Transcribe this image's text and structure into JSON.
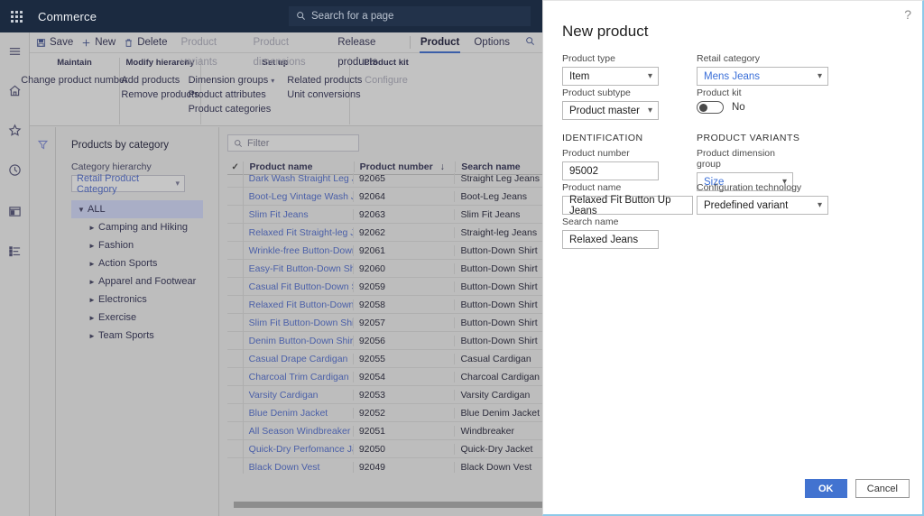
{
  "topbar": {
    "waffle_icon": "app-launcher-icon",
    "title": "Commerce",
    "search_icon": "search-icon",
    "search_placeholder": "Search for a page"
  },
  "rail": {
    "items": [
      {
        "name": "hamburger-icon",
        "label": "Expand navigation"
      },
      {
        "name": "home-icon",
        "label": "Home"
      },
      {
        "name": "star-icon",
        "label": "Favorites"
      },
      {
        "name": "clock-icon",
        "label": "Recent"
      },
      {
        "name": "workspace-icon",
        "label": "Workspaces"
      },
      {
        "name": "modules-icon",
        "label": "Modules"
      }
    ]
  },
  "ribbon": {
    "quick_actions": [
      {
        "label": "Save",
        "icon": "save-icon",
        "disabled": false
      },
      {
        "label": "New",
        "icon": "plus-icon",
        "disabled": false
      },
      {
        "label": "Delete",
        "icon": "trash-icon",
        "disabled": false
      }
    ],
    "tabs": [
      {
        "label": "Product variants",
        "active": false,
        "disabled": true
      },
      {
        "label": "Product dimensions",
        "active": false,
        "disabled": true
      },
      {
        "label": "Release products",
        "active": false,
        "disabled": false
      },
      {
        "label": "Product",
        "active": true,
        "disabled": false
      },
      {
        "label": "Options",
        "active": false,
        "disabled": false
      }
    ],
    "search_icon": "search-icon",
    "groups": [
      {
        "title": "Maintain",
        "columns": [
          {
            "items": [
              {
                "label": "Change product number",
                "disabled": false
              }
            ]
          }
        ]
      },
      {
        "title": "Modify hierarchy",
        "columns": [
          {
            "items": [
              {
                "label": "Add products",
                "disabled": false
              },
              {
                "label": "Remove products",
                "disabled": false
              }
            ]
          }
        ]
      },
      {
        "title": "Set up",
        "columns": [
          {
            "items": [
              {
                "label": "Dimension groups",
                "disabled": false,
                "chevron": true
              },
              {
                "label": "Product attributes",
                "disabled": false
              },
              {
                "label": "Product categories",
                "disabled": false
              }
            ]
          },
          {
            "items": [
              {
                "label": "Related products",
                "disabled": false
              },
              {
                "label": "Unit conversions",
                "disabled": false
              }
            ]
          }
        ]
      },
      {
        "title": "Product kit",
        "columns": [
          {
            "items": [
              {
                "label": "Configure",
                "disabled": true
              }
            ]
          }
        ]
      }
    ]
  },
  "filter_rail": {
    "icon": "filter-icon"
  },
  "category_pane": {
    "heading": "Products by category",
    "hierarchy_label": "Category hierarchy",
    "hierarchy_value": "Retail Product Category",
    "chevron_icon": "chevron-down-icon",
    "tree": [
      {
        "label": "ALL",
        "level": 0,
        "selected": true,
        "expanded": true
      },
      {
        "label": "Camping and Hiking",
        "level": 1,
        "selected": false,
        "expanded": false
      },
      {
        "label": "Fashion",
        "level": 1,
        "selected": false,
        "expanded": false
      },
      {
        "label": "Action Sports",
        "level": 1,
        "selected": false,
        "expanded": false
      },
      {
        "label": "Apparel and Footwear",
        "level": 1,
        "selected": false,
        "expanded": false
      },
      {
        "label": "Electronics",
        "level": 1,
        "selected": false,
        "expanded": false
      },
      {
        "label": "Exercise",
        "level": 1,
        "selected": false,
        "expanded": false
      },
      {
        "label": "Team Sports",
        "level": 1,
        "selected": false,
        "expanded": false
      }
    ]
  },
  "grid": {
    "filter_placeholder": "Filter",
    "filter_icon": "search-icon",
    "select_all_icon": "checkmark-icon",
    "columns": [
      "Product name",
      "Product number",
      "Search name"
    ],
    "sort_column": "Product number",
    "sort_icon": "sort-descending-icon",
    "rows": [
      {
        "product_name": "Dark Wash Straight Leg Jeans",
        "product_number": "92065",
        "search_name": "Straight Leg Jeans"
      },
      {
        "product_name": "Boot-Leg Vintage Wash Jeans",
        "product_number": "92064",
        "search_name": "Boot-Leg Jeans"
      },
      {
        "product_name": "Slim Fit Jeans",
        "product_number": "92063",
        "search_name": "Slim Fit Jeans"
      },
      {
        "product_name": "Relaxed Fit Straight-leg Jeans",
        "product_number": "92062",
        "search_name": "Straight-leg Jeans"
      },
      {
        "product_name": "Wrinkle-free Button-Down Shirt",
        "product_number": "92061",
        "search_name": "Button-Down Shirt"
      },
      {
        "product_name": "Easy-Fit Button-Down Shirt",
        "product_number": "92060",
        "search_name": "Button-Down Shirt"
      },
      {
        "product_name": "Casual Fit Button-Down Shirt",
        "product_number": "92059",
        "search_name": "Button-Down Shirt"
      },
      {
        "product_name": "Relaxed Fit Button-Down Shirt",
        "product_number": "92058",
        "search_name": "Button-Down Shirt"
      },
      {
        "product_name": "Slim Fit Button-Down Shirt",
        "product_number": "92057",
        "search_name": "Button-Down Shirt"
      },
      {
        "product_name": "Denim Button-Down Shirt",
        "product_number": "92056",
        "search_name": "Button-Down Shirt"
      },
      {
        "product_name": "Casual Drape Cardigan",
        "product_number": "92055",
        "search_name": "Casual Cardigan"
      },
      {
        "product_name": "Charcoal Trim Cardigan",
        "product_number": "92054",
        "search_name": "Charcoal Cardigan"
      },
      {
        "product_name": "Varsity Cardigan",
        "product_number": "92053",
        "search_name": "Varsity Cardigan"
      },
      {
        "product_name": "Blue Denim Jacket",
        "product_number": "92052",
        "search_name": "Blue Denim Jacket"
      },
      {
        "product_name": "All Season Windbreaker",
        "product_number": "92051",
        "search_name": "Windbreaker"
      },
      {
        "product_name": "Quick-Dry Perfomance Jacket",
        "product_number": "92050",
        "search_name": "Quick-Dry Jacket"
      },
      {
        "product_name": "Black Down Vest",
        "product_number": "92049",
        "search_name": "Black Down Vest"
      }
    ]
  },
  "dialog": {
    "title": "New product",
    "help_icon": "help-icon",
    "fields": {
      "product_type": {
        "label": "Product type",
        "value": "Item"
      },
      "retail_category": {
        "label": "Retail category",
        "value": "Mens Jeans"
      },
      "product_subtype": {
        "label": "Product subtype",
        "value": "Product master"
      },
      "product_kit": {
        "label": "Product kit",
        "value": "No",
        "state": "off"
      },
      "identification_section": "IDENTIFICATION",
      "product_variants_section": "PRODUCT VARIANTS",
      "product_number": {
        "label": "Product number",
        "value": "95002"
      },
      "product_dimension_group": {
        "label": "Product dimension group",
        "value": "Size"
      },
      "product_name": {
        "label": "Product name",
        "value": "Relaxed Fit Button Up Jeans"
      },
      "configuration_technology": {
        "label": "Configuration technology",
        "value": "Predefined variant"
      },
      "search_name": {
        "label": "Search name",
        "value": "Relaxed Jeans"
      }
    },
    "buttons": {
      "ok": "OK",
      "cancel": "Cancel"
    },
    "chevron_icon": "chevron-down-icon"
  },
  "colors": {
    "topbar_bg": "#1b2a40",
    "accent_link": "#4a5fa8",
    "dialog_link": "#3a6fd8",
    "primary_button": "#4273d0",
    "tab_underline": "#3b5ea8",
    "dialog_border": "#8ec9e8"
  }
}
